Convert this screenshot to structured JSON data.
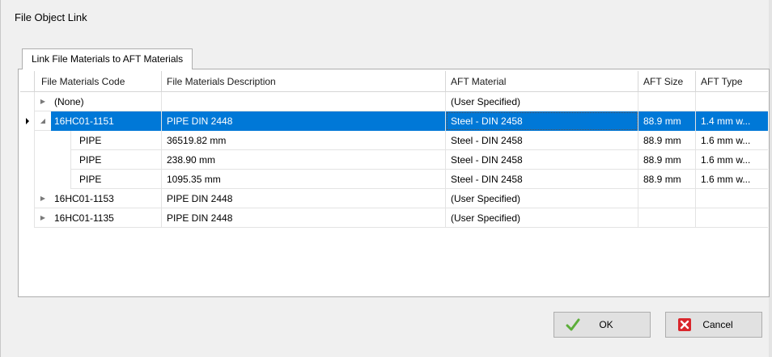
{
  "window": {
    "title": "File Object Link"
  },
  "tab": {
    "label": "Link File Materials to AFT Materials"
  },
  "grid": {
    "columns": [
      "File Materials Code",
      "File Materials Description",
      "AFT Material",
      "AFT Size",
      "AFT Type"
    ],
    "rows": [
      {
        "code": "(None)",
        "description": "",
        "material": "(User Specified)",
        "size": "",
        "type": "",
        "expander": "collapsed"
      },
      {
        "code": "16HC01-1151",
        "description": "PIPE DIN 2448",
        "material": "Steel - DIN 2458",
        "size": "88.9 mm",
        "type": "1.4 mm w...",
        "expander": "expanded",
        "selected": true
      },
      {
        "code": "PIPE",
        "description": "36519.82 mm",
        "material": "Steel - DIN 2458",
        "size": "88.9 mm",
        "type": "1.6 mm w...",
        "child": true
      },
      {
        "code": "PIPE",
        "description": "238.90 mm",
        "material": "Steel - DIN 2458",
        "size": "88.9 mm",
        "type": "1.6 mm w...",
        "child": true
      },
      {
        "code": "PIPE",
        "description": "1095.35 mm",
        "material": "Steel - DIN 2458",
        "size": "88.9 mm",
        "type": "1.6 mm w...",
        "child": true
      },
      {
        "code": "16HC01-1153",
        "description": "PIPE DIN 2448",
        "material": "(User Specified)",
        "size": "",
        "type": "",
        "expander": "collapsed"
      },
      {
        "code": "16HC01-1135",
        "description": "PIPE DIN 2448",
        "material": "(User Specified)",
        "size": "",
        "type": "",
        "expander": "collapsed"
      }
    ]
  },
  "buttons": {
    "ok": {
      "label": "OK",
      "icon": "checkmark-icon"
    },
    "cancel": {
      "label": "Cancel",
      "icon": "close-x-icon"
    }
  },
  "colors": {
    "selection": "#0078d7",
    "ok_icon": "#5cae3a",
    "cancel_icon": "#d9262c"
  }
}
